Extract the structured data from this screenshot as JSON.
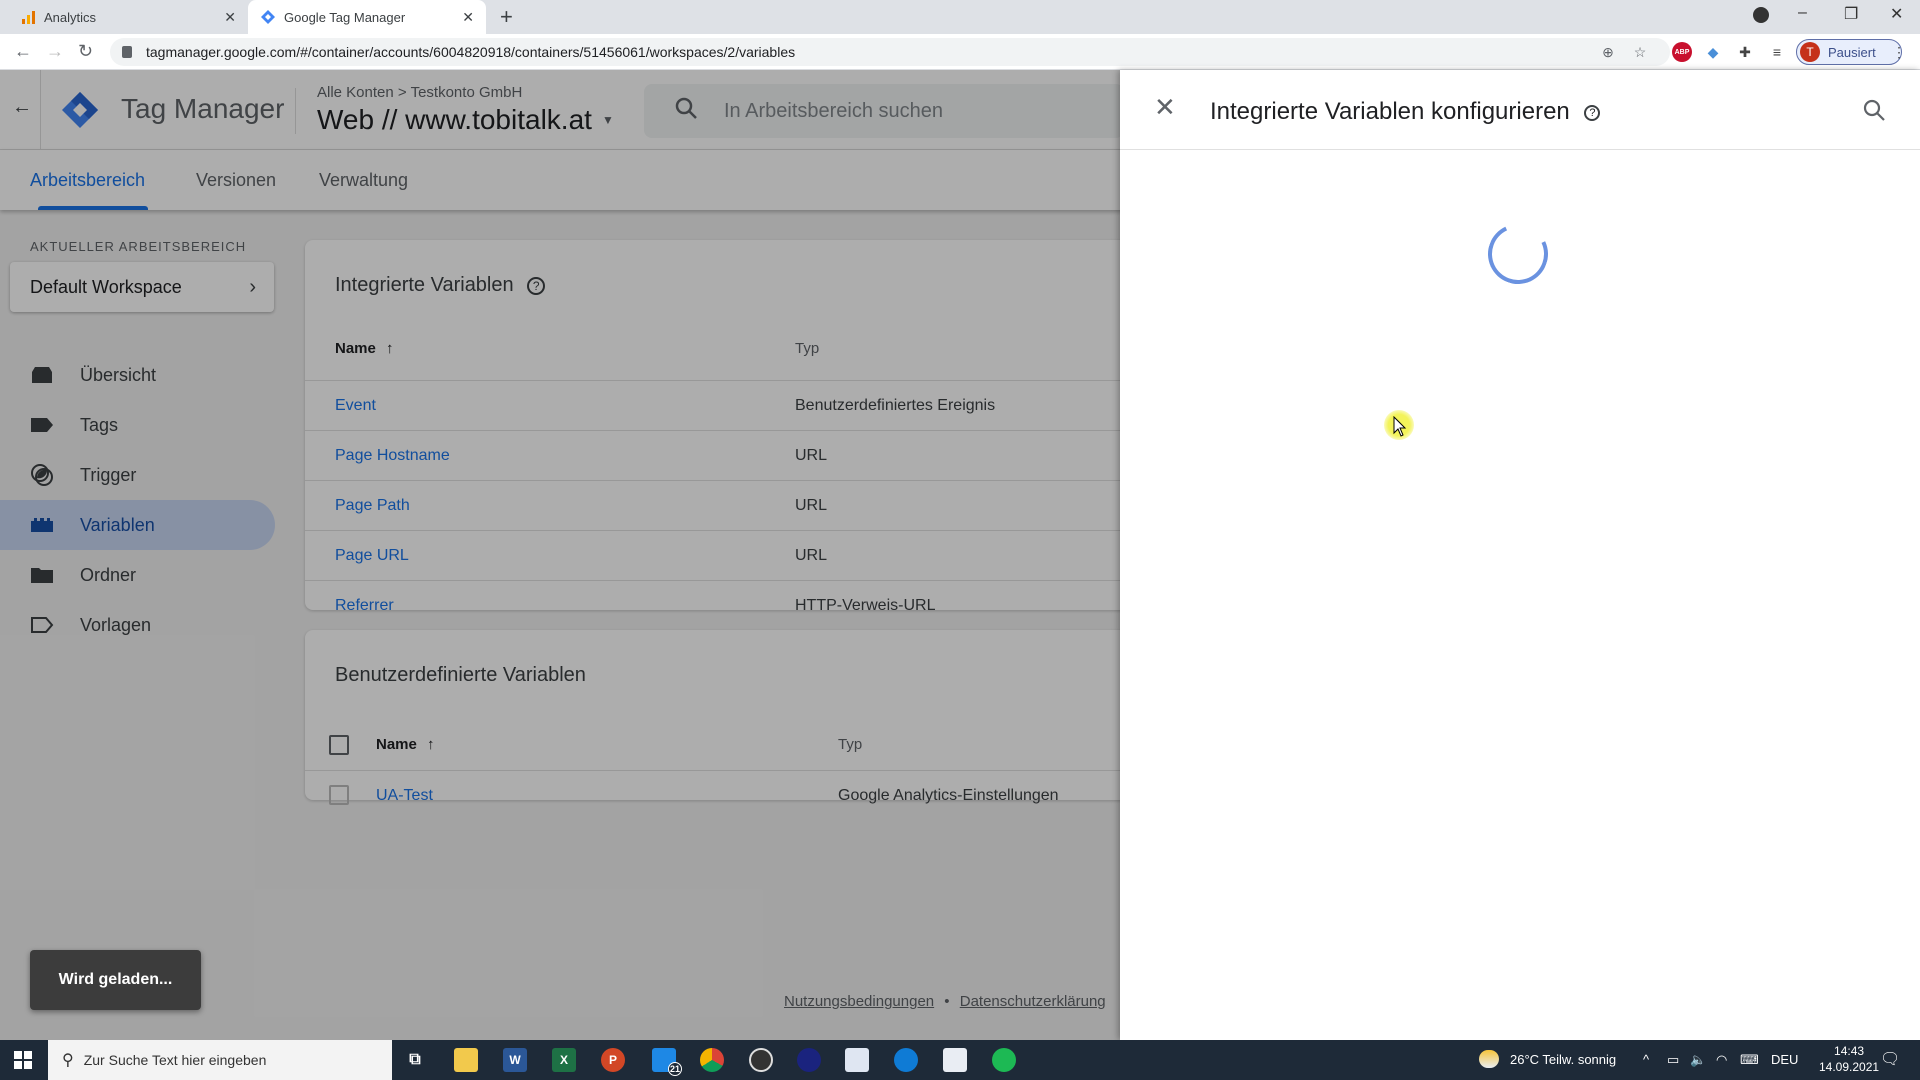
{
  "browser": {
    "tabs": [
      {
        "label": "Analytics",
        "icon": "analytics-icon",
        "active": false
      },
      {
        "label": "Google Tag Manager",
        "icon": "gtm-icon",
        "active": true
      }
    ],
    "url": "tagmanager.google.com/#/container/accounts/6004820918/containers/51456061/workspaces/2/variables",
    "profile_label": "Pausiert",
    "profile_initial": "T",
    "extensions": [
      "zoom-icon",
      "star-icon",
      "adblock-icon",
      "tag-assistant-icon",
      "extensions-puzzle-icon",
      "media-control-icon"
    ]
  },
  "header": {
    "app_name": "Tag Manager",
    "breadcrumb_account": "Alle Konten",
    "breadcrumb_sep": ">",
    "breadcrumb_container": "Testkonto GmbH",
    "container_name": "Web // www.tobitalk.at",
    "search_placeholder": "In Arbeitsbereich suchen"
  },
  "subtabs": [
    {
      "label": "Arbeitsbereich",
      "active": true
    },
    {
      "label": "Versionen",
      "active": false
    },
    {
      "label": "Verwaltung",
      "active": false
    }
  ],
  "sidebar": {
    "workspace_heading": "AKTUELLER ARBEITSBEREICH",
    "workspace_name": "Default Workspace",
    "items": [
      {
        "label": "Übersicht",
        "icon": "overview-icon"
      },
      {
        "label": "Tags",
        "icon": "tag-icon"
      },
      {
        "label": "Trigger",
        "icon": "trigger-icon"
      },
      {
        "label": "Variablen",
        "icon": "variables-icon",
        "active": true
      },
      {
        "label": "Ordner",
        "icon": "folder-icon"
      },
      {
        "label": "Vorlagen",
        "icon": "template-icon"
      }
    ]
  },
  "builtin_variables": {
    "title": "Integrierte Variablen",
    "col_name": "Name",
    "col_type": "Typ",
    "rows": [
      {
        "name": "Event",
        "type": "Benutzerdefiniertes Ereignis"
      },
      {
        "name": "Page Hostname",
        "type": "URL"
      },
      {
        "name": "Page Path",
        "type": "URL"
      },
      {
        "name": "Page URL",
        "type": "URL"
      },
      {
        "name": "Referrer",
        "type": "HTTP-Verweis-URL"
      }
    ]
  },
  "custom_variables": {
    "title": "Benutzerdefinierte Variablen",
    "col_name": "Name",
    "col_type": "Typ",
    "rows": [
      {
        "name": "UA-Test",
        "type": "Google Analytics-Einstellungen"
      }
    ]
  },
  "toast": "Wird geladen...",
  "footer": {
    "terms": "Nutzungsbedingungen",
    "sep": "•",
    "privacy": "Datenschutzerklärung"
  },
  "panel": {
    "title": "Integrierte Variablen konfigurieren",
    "state": "loading"
  },
  "taskbar": {
    "search_placeholder": "Zur Suche Text hier eingeben",
    "mail_badge": "21",
    "weather": "26°C  Teilw. sonnig",
    "language": "DEU",
    "time": "14:43",
    "date": "14.09.2021"
  },
  "colors": {
    "accent": "#1a73e8",
    "spinner": "#6a92e0",
    "nav_active_bg": "#c8d6f2"
  }
}
